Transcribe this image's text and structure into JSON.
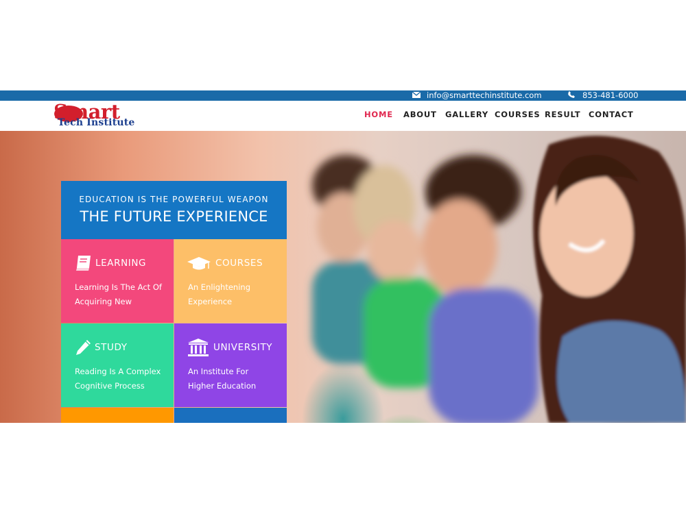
{
  "topbar": {
    "email": "info@smarttechinstitute.com",
    "phone": "853-481-6000",
    "email_icon": "envelope-icon",
    "phone_icon": "phone-icon"
  },
  "logo": {
    "line1": "Smart",
    "line2": "Tech Institute"
  },
  "nav": {
    "items": [
      "HOME",
      "ABOUT",
      "GALLERY",
      "COURSES",
      "RESULT",
      "CONTACT"
    ],
    "active": "HOME",
    "active_color": "#e0284f"
  },
  "hero": {
    "subtitle": "EDUCATION IS THE POWERFUL WEAPON",
    "title": "THE FUTURE EXPERIENCE"
  },
  "tiles": [
    {
      "title": "LEARNING",
      "line1": "Learning Is The Act Of",
      "line2": "Acquiring New",
      "icon": "book-icon",
      "color": "#f3487c"
    },
    {
      "title": "COURSES",
      "line1": "An Enlightening",
      "line2": "Experience",
      "icon": "graduation-cap-icon",
      "color": "#fdbf68"
    },
    {
      "title": "STUDY",
      "line1": "Reading Is A Complex",
      "line2": "Cognitive Process",
      "icon": "pencil-icon",
      "color": "#2fd99c"
    },
    {
      "title": "UNIVERSITY",
      "line1": "An Institute For",
      "line2": "Higher Education",
      "icon": "institution-icon",
      "color": "#8f45e6"
    }
  ],
  "colors": {
    "topbar": "#1a6aa8",
    "panel_head": "#1576c4",
    "tile_orange": "#ff9800",
    "tile_blue": "#1a6fbe"
  }
}
